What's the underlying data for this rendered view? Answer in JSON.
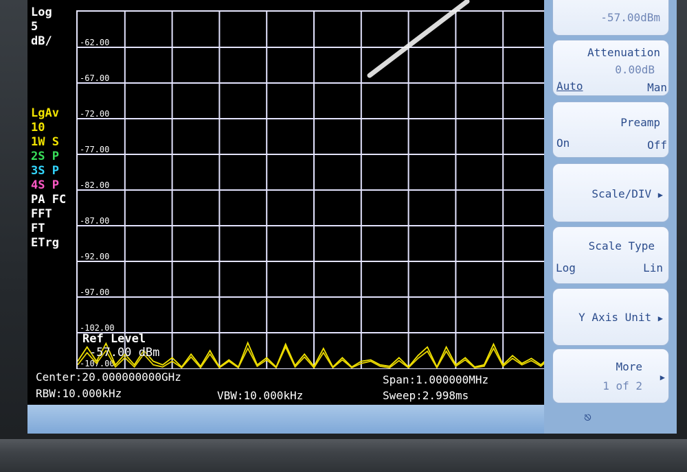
{
  "screen": {
    "left_annotations": [
      {
        "text": "Log",
        "color": "#ffffff"
      },
      {
        "text": "5",
        "color": "#ffffff"
      },
      {
        "text": "dB/",
        "color": "#ffffff"
      },
      {
        "text": "",
        "color": "#ffffff"
      },
      {
        "text": "",
        "color": "#ffffff"
      },
      {
        "text": "",
        "color": "#ffffff"
      },
      {
        "text": "",
        "color": "#ffffff"
      },
      {
        "text": "LgAv",
        "color": "#f2e400"
      },
      {
        "text": "10",
        "color": "#f2e400"
      },
      {
        "text": "1W S",
        "color": "#f2e400"
      },
      {
        "text": "2S P",
        "color": "#39e05a"
      },
      {
        "text": "3S P",
        "color": "#33d6ff"
      },
      {
        "text": "4S P",
        "color": "#ff59c6"
      },
      {
        "text": "PA FC",
        "color": "#ffffff"
      },
      {
        "text": "FFT",
        "color": "#ffffff"
      },
      {
        "text": "FT",
        "color": "#ffffff"
      },
      {
        "text": "ETrg",
        "color": "#ffffff"
      }
    ],
    "ref_level_box": {
      "label": "Ref Level",
      "value": "-57.00 dBm"
    },
    "bottom": {
      "center": "Center:20.000000000GHz",
      "rbw": "RBW:10.000kHz",
      "vbw": "VBW:10.000kHz",
      "span": "Span:1.000000MHz",
      "sweep": "Sweep:2.998ms"
    }
  },
  "chart_data": {
    "type": "line",
    "y_tick_labels": [
      "-62.00",
      "-67.00",
      "-72.00",
      "-77.00",
      "-82.00",
      "-87.00",
      "-92.00",
      "-97.00",
      "-102.00",
      "-107.00"
    ],
    "ylim": [
      -107,
      -57
    ],
    "xlim": [
      0,
      10
    ],
    "grid": true,
    "series": [
      {
        "color": "#f2e400",
        "x": [
          0,
          0.2,
          0.4,
          0.6,
          0.8,
          1.0,
          1.2,
          1.4,
          1.6,
          1.8,
          2.0,
          2.2,
          2.4,
          2.6,
          2.8,
          3.0,
          3.2,
          3.4,
          3.6,
          3.8,
          4.0,
          4.2,
          4.4,
          4.6,
          4.8,
          5.0,
          5.2,
          5.4,
          5.6,
          5.8,
          6.0,
          6.2,
          6.4,
          6.6,
          6.8,
          7.0,
          7.2,
          7.4,
          7.6,
          7.8,
          8.0,
          8.2,
          8.4,
          8.6,
          8.8,
          9.0,
          9.2,
          9.4,
          9.6,
          9.8,
          10.0
        ],
        "y": [
          -106,
          -104,
          -106,
          -103.5,
          -106.5,
          -105,
          -106.5,
          -104.5,
          -106,
          -106.5,
          -105.5,
          -106.8,
          -105,
          -106.7,
          -104.5,
          -106.8,
          -105.8,
          -106.8,
          -103.4,
          -106.5,
          -105.5,
          -106.8,
          -103.6,
          -106.6,
          -105,
          -106.7,
          -104.2,
          -106.8,
          -105.5,
          -106.8,
          -106,
          -105.8,
          -106.5,
          -106.7,
          -105.5,
          -106.8,
          -105.2,
          -104,
          -106.8,
          -104,
          -106.5,
          -105.5,
          -106.8,
          -106.5,
          -103.6,
          -106.5,
          -105.2,
          -106.3,
          -105.6,
          -106.5,
          -105.3
        ]
      },
      {
        "color": "#e8d400",
        "x": [
          0,
          0.2,
          0.4,
          0.6,
          0.8,
          1.0,
          1.2,
          1.4,
          1.6,
          1.8,
          2.0,
          2.2,
          2.4,
          2.6,
          2.8,
          3.0,
          3.2,
          3.4,
          3.6,
          3.8,
          4.0,
          4.2,
          4.4,
          4.6,
          4.8,
          5.0,
          5.2,
          5.4,
          5.6,
          5.8,
          6.0,
          6.2,
          6.4,
          6.6,
          6.8,
          7.0,
          7.2,
          7.4,
          7.6,
          7.8,
          8.0,
          8.2,
          8.4,
          8.6,
          8.8,
          9.0,
          9.2,
          9.4,
          9.6,
          9.8,
          10.0
        ],
        "y": [
          -106.5,
          -104.8,
          -106.3,
          -104.5,
          -106.8,
          -105.5,
          -106.8,
          -105,
          -106.5,
          -106.8,
          -106,
          -106.9,
          -105.4,
          -106.9,
          -105,
          -106.9,
          -106,
          -106.9,
          -104.2,
          -106.7,
          -105.8,
          -106.9,
          -104,
          -106.8,
          -105.4,
          -106.9,
          -104.8,
          -106.9,
          -105.8,
          -106.9,
          -106.3,
          -106,
          -106.7,
          -106.9,
          -105.9,
          -106.9,
          -105.6,
          -104.6,
          -106.9,
          -104.6,
          -106.7,
          -105.8,
          -106.9,
          -106.7,
          -104.2,
          -106.7,
          -105.6,
          -106.5,
          -105.9,
          -106.7,
          -105.6
        ]
      }
    ]
  },
  "softkeys": {
    "ref_level_value": "-57.00dBm",
    "attenuation": {
      "title": "Attenuation",
      "value": "0.00dB",
      "left": "Auto",
      "right": "Man"
    },
    "preamp": {
      "title": "Preamp",
      "left": "On",
      "right": "Off"
    },
    "scale_div": {
      "title": "Scale/DIV"
    },
    "scale_type": {
      "title": "Scale Type",
      "left": "Log",
      "right": "Lin"
    },
    "y_axis_unit": {
      "title": "Y Axis Unit"
    },
    "more": {
      "title": "More",
      "sub": "1 of 2"
    }
  }
}
